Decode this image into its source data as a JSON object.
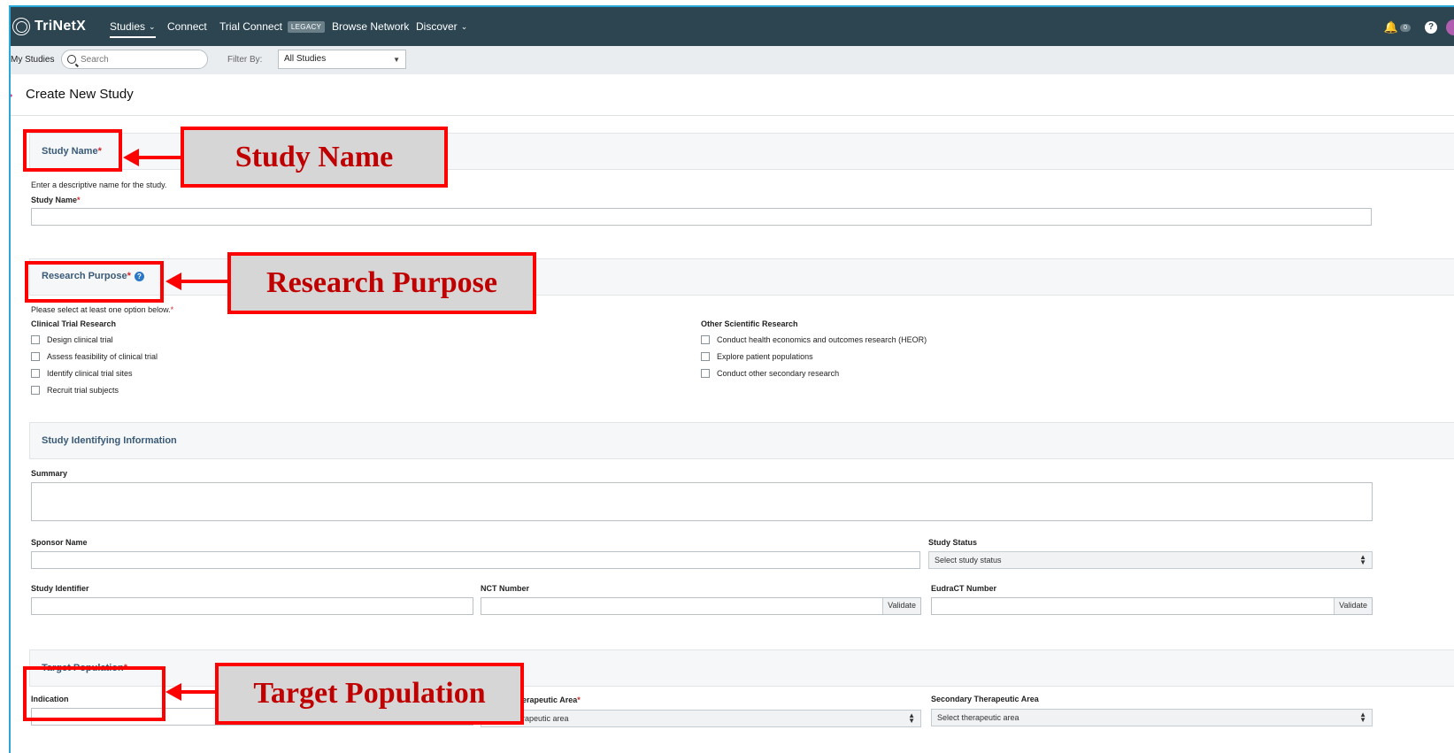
{
  "nav": {
    "logo": "TriNetX",
    "items": [
      {
        "label": "Studies",
        "chevron": true,
        "active": true
      },
      {
        "label": "Connect"
      },
      {
        "label": "Trial Connect",
        "badge": "LEGACY"
      },
      {
        "label": "Browse Network"
      },
      {
        "label": "Discover",
        "chevron": true
      }
    ],
    "notification_count": "0",
    "help_glyph": "?"
  },
  "subbar": {
    "my_studies": "My Studies",
    "search_placeholder": "Search",
    "filter_label": "Filter By:",
    "filter_value": "All Studies"
  },
  "page": {
    "title": "Create New Study"
  },
  "study_name": {
    "section_title": "Study Name",
    "hint": "Enter a descriptive name for the study.",
    "field_label": "Study Name"
  },
  "research_purpose": {
    "section_title": "Research Purpose",
    "hint": "Please select at least one option below.",
    "clinical_heading": "Clinical Trial Research",
    "clinical_options": [
      "Design clinical trial",
      "Assess feasibility of clinical trial",
      "Identify clinical trial sites",
      "Recruit trial subjects"
    ],
    "other_heading": "Other Scientific Research",
    "other_options": [
      "Conduct health economics and outcomes research (HEOR)",
      "Explore patient populations",
      "Conduct other secondary research"
    ]
  },
  "identifying": {
    "section_title": "Study Identifying Information",
    "summary_label": "Summary",
    "sponsor_label": "Sponsor Name",
    "status_label": "Study Status",
    "status_placeholder": "Select study status",
    "identifier_label": "Study Identifier",
    "nct_label": "NCT Number",
    "eudract_label": "EudraCT Number",
    "validate_label": "Validate"
  },
  "target_population": {
    "section_title": "Target Population",
    "indication_label": "Indication",
    "primary_area_label": "Primary Therapeutic Area",
    "primary_area_placeholder": "Select therapeutic area",
    "secondary_area_label": "Secondary Therapeutic Area",
    "secondary_area_placeholder": "Select therapeutic area"
  },
  "annotations": {
    "study_name": "Study Name",
    "research_purpose": "Research Purpose",
    "target_population": "Target Population"
  },
  "colors": {
    "nav_bg": "#2c4551",
    "section_title": "#3a5a78",
    "required": "#d62828",
    "annotation_red": "#ff0000",
    "annotation_text": "#c00000"
  }
}
